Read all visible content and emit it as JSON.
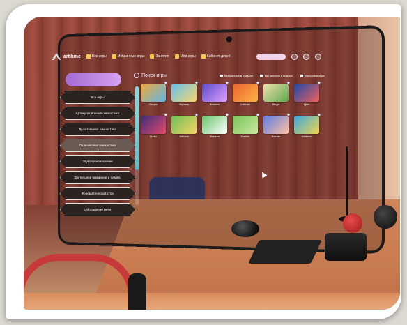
{
  "app": {
    "logo_text": "artikme"
  },
  "topbar": {
    "items": [
      {
        "label": "Все игры",
        "icon": "gamepad-icon"
      },
      {
        "label": "Избранные игры",
        "icon": "star-icon"
      },
      {
        "label": "Занятия",
        "icon": "book-icon"
      },
      {
        "label": "Мои игры",
        "icon": "folder-icon"
      },
      {
        "label": "Кабинет детей",
        "icon": "user-icon"
      }
    ]
  },
  "menu": {
    "title": "",
    "items": [
      {
        "label": "Все игры"
      },
      {
        "label": "Артикуляционная гимнастика"
      },
      {
        "label": "Дыхательная гимнастика"
      },
      {
        "label": "Пальчиковая гимнастика",
        "active": true
      },
      {
        "label": "Звукопроизношение"
      },
      {
        "label": "Зрительное внимание и память"
      },
      {
        "label": "Фонематический слух"
      },
      {
        "label": "Обогащение речи"
      }
    ]
  },
  "search": {
    "label": "Поиск игры"
  },
  "filters": [
    {
      "label": "Выбранные в разделе"
    },
    {
      "label": "Тип занятия и возраст"
    },
    {
      "label": "Настройки игры"
    }
  ],
  "games": [
    {
      "label": "Отгоры",
      "color1": "#f2a93b",
      "color2": "#5fb6e5"
    },
    {
      "label": "Вертики",
      "color1": "#63c0f0",
      "color2": "#f8d66b"
    },
    {
      "label": "Фламинг",
      "color1": "#5b4bc9",
      "color2": "#e0a0ff"
    },
    {
      "label": "Сабочки",
      "color1": "#e9622f",
      "color2": "#ffb347"
    },
    {
      "label": "Ягоды",
      "color1": "#f1e0b0",
      "color2": "#5ba84a"
    },
    {
      "label": "Цвет",
      "color1": "#1c4aa8",
      "color2": "#f25f5c"
    },
    {
      "label": "Бинго",
      "color1": "#3c2e7a",
      "color2": "#e3486b"
    },
    {
      "label": "Зайчики",
      "color1": "#6bbf59",
      "color2": "#f6d365"
    },
    {
      "label": "Мышики",
      "color1": "#69c56a",
      "color2": "#ffffff"
    },
    {
      "label": "Камень",
      "color1": "#7ac45a",
      "color2": "#c9e7a0"
    },
    {
      "label": "Нюхики",
      "color1": "#5c7ee6",
      "color2": "#ffc0a0"
    },
    {
      "label": "Анимали",
      "color1": "#39a9e0",
      "color2": "#f2d44c"
    }
  ],
  "colors": {
    "accent": "#a46bd4",
    "scroll": "#7fe1e8"
  }
}
